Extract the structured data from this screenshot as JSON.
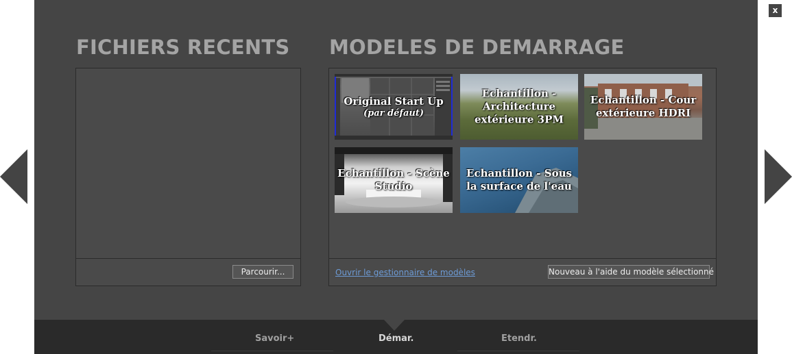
{
  "close": {
    "label": "x"
  },
  "recent": {
    "title": "FICHIERS RECENTS",
    "browse_label": "Parcourir..."
  },
  "templates": {
    "title": "MODELES DE DEMARRAGE",
    "items": [
      {
        "name": "Original Start Up",
        "sub": "(par défaut)",
        "selected": true
      },
      {
        "name": "Echantillon - Architecture extérieure 3PM",
        "sub": ""
      },
      {
        "name": "Echantillon - Cour extérieure HDRI",
        "sub": ""
      },
      {
        "name": "Echantillon - Scène Studio",
        "sub": ""
      },
      {
        "name": "Echantillon - Sous la surface de l'eau",
        "sub": ""
      }
    ],
    "manager_link": "Ouvrir le gestionnaire de modèles",
    "new_button": "Nouveau à l'aide du modèle sélectionné"
  },
  "bottom_tabs": [
    {
      "label": "Savoir+",
      "active": false
    },
    {
      "label": "Démar.",
      "active": true
    },
    {
      "label": "Etendr.",
      "active": false
    }
  ],
  "colors": {
    "panel": "#454545",
    "bottom_bar": "#2a2a2a",
    "title_text": "#a4a4a4",
    "link": "#6d9bd6",
    "selection": "#1f2bd6"
  },
  "icons": {
    "prev": "chevron-left-icon",
    "next": "chevron-right-icon",
    "close": "close-icon",
    "tab_pointer": "triangle-down-icon"
  }
}
